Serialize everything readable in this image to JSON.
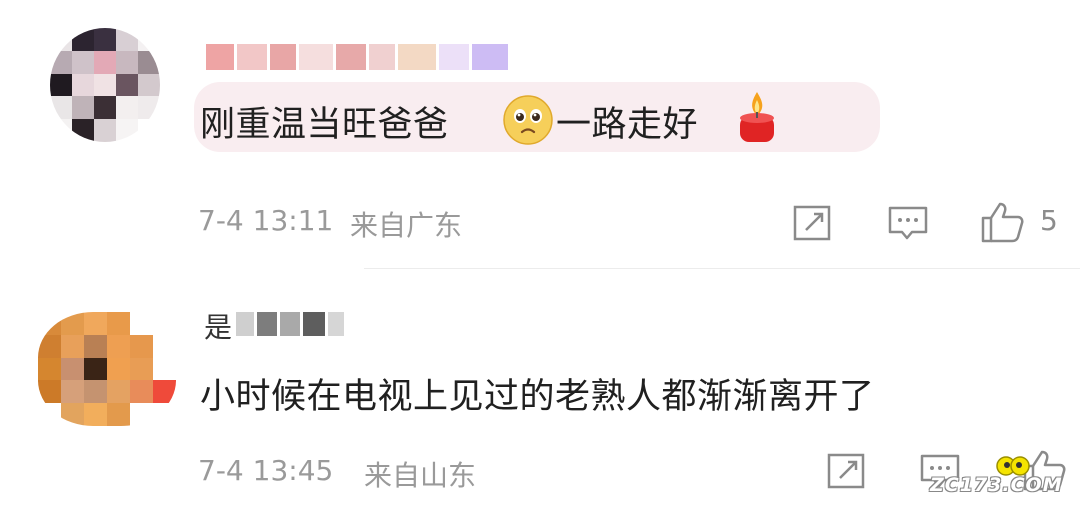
{
  "comments": [
    {
      "text": "刚重温当旺爸爸",
      "emoji_1": "pleading-face-emoji",
      "text_2": "一路走好",
      "emoji_2": "candle-emoji",
      "time": "7-4 13:11",
      "location": "来自广东",
      "likes": "5"
    },
    {
      "username_partial": "是",
      "text": "小时候在电视上见过的老熟人都渐渐离开了",
      "time": "7-4 13:45",
      "location": "来自山东"
    }
  ],
  "icons": {
    "share": "share-icon",
    "reply": "comment-icon",
    "like": "thumbs-up-icon"
  },
  "watermark": "ZC173.COM",
  "colors": {
    "bubble": "#f9edf0",
    "meta_text": "#9a9a9a",
    "icon": "#8a8a8a"
  }
}
